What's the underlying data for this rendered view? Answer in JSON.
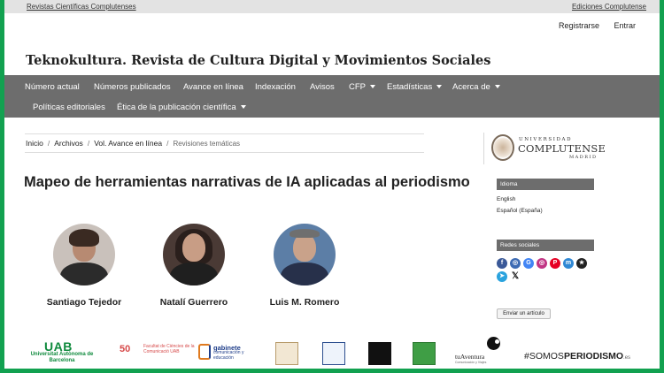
{
  "topbar": {
    "left_link": "Revistas Científicas Complutenses",
    "right_link": "Ediciones Complutense"
  },
  "user_nav": {
    "register": "Registrarse",
    "login": "Entrar"
  },
  "site_title": "Teknokultura. Revista de Cultura Digital y Movimientos Sociales",
  "nav": {
    "items": [
      {
        "label": "Número actual"
      },
      {
        "label": "Números publicados"
      },
      {
        "label": "Avance en línea"
      },
      {
        "label": "Indexación"
      },
      {
        "label": "Avisos"
      },
      {
        "label": "CFP"
      },
      {
        "label": "Estadísticas"
      },
      {
        "label": "Acerca de"
      },
      {
        "label": "Políticas editoriales"
      },
      {
        "label": "Ética de la publicación científica"
      }
    ]
  },
  "breadcrumb": {
    "items": [
      "Inicio",
      "Archivos",
      "Vol. Avance en línea"
    ],
    "current": "Revisiones temáticas",
    "separator": "/"
  },
  "brand_logo": {
    "line1": "UNIVERSIDAD",
    "line2": "COMPLUTENSE",
    "line3": "MADRID"
  },
  "article": {
    "title": "Mapeo de herramientas narrativas de IA aplicadas al periodismo",
    "authors": [
      {
        "name": "Santiago Tejedor"
      },
      {
        "name": "Natalí Guerrero"
      },
      {
        "name": "Luis M. Romero"
      }
    ]
  },
  "sidebar": {
    "language_header": "Idioma",
    "languages": [
      "English",
      "Español (España)"
    ],
    "social_header": "Redes sociales",
    "social_icons": [
      "facebook-icon",
      "instagram-icon",
      "google-icon",
      "instagram-icon",
      "pinterest-icon",
      "mastodon-icon",
      "star-icon",
      "telegram-icon",
      "x-icon"
    ],
    "submit_button": "Enviar un artículo"
  },
  "footer_logos": {
    "uab_name": "UAB",
    "uab_full": "Universitat Autònoma de Barcelona",
    "anys": "50",
    "anys_caption": "Facultat de Ciències de la Comunicació UAB",
    "gabinete": "gabinete",
    "gabinete_caption": "comunicación y educación",
    "tuaventura": "tuAventura",
    "tuaventura_caption": "Comunicación y Viajes",
    "somos_prefix": "#SOMOS",
    "somos_bold": "PERIODISMO",
    "somos_suffix": ".es"
  },
  "colors": {
    "frame": "#12a150",
    "navbar": "#6d6d6d",
    "block_header": "#6d6d6d"
  }
}
